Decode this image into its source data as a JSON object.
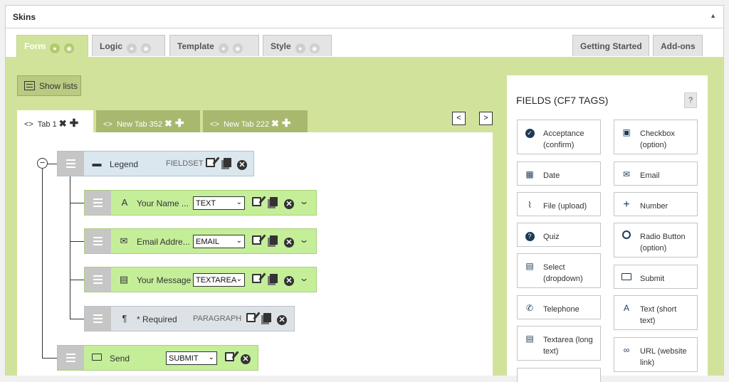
{
  "panel": {
    "title": "Skins"
  },
  "top_tabs": [
    {
      "label": "Form",
      "active": true
    },
    {
      "label": "Logic",
      "active": false
    },
    {
      "label": "Template",
      "active": false
    },
    {
      "label": "Style",
      "active": false
    }
  ],
  "right_tabs": [
    {
      "label": "Getting Started"
    },
    {
      "label": "Add-ons"
    }
  ],
  "show_lists_label": "Show lists",
  "sub_tabs": [
    {
      "label": "Tab 1",
      "active": true
    },
    {
      "label": "New Tab 352",
      "active": false
    },
    {
      "label": "New Tab 222",
      "active": false
    }
  ],
  "form_rows": [
    {
      "label": "Legend",
      "type": "FIELDSET",
      "icon": "folder-icon"
    },
    {
      "label": "Your Name ...",
      "type": "TEXT",
      "icon": "text-icon"
    },
    {
      "label": "Email Addre...",
      "type": "EMAIL",
      "icon": "envelope-icon"
    },
    {
      "label": "Your Message",
      "type": "TEXTAREA",
      "icon": "textarea-icon"
    },
    {
      "label": "* Required",
      "type": "PARAGRAPH",
      "icon": "paragraph-icon"
    },
    {
      "label": "Send",
      "type": "SUBMIT",
      "icon": "button-icon"
    }
  ],
  "sidebar": {
    "title": "FIELDS (CF7 TAGS)",
    "help": "?",
    "fields": [
      {
        "label": "Acceptance (confirm)",
        "icon": "check-circle-icon"
      },
      {
        "label": "Checkbox (option)",
        "icon": "checkbox-icon"
      },
      {
        "label": "Date",
        "icon": "calendar-icon"
      },
      {
        "label": "Email",
        "icon": "envelope-icon"
      },
      {
        "label": "File (upload)",
        "icon": "paperclip-icon"
      },
      {
        "label": "Number",
        "icon": "plus-icon"
      },
      {
        "label": "Quiz",
        "icon": "question-circle-icon"
      },
      {
        "label": "Radio Button (option)",
        "icon": "radio-icon"
      },
      {
        "label": "Select (dropdown)",
        "icon": "list-icon"
      },
      {
        "label": "Submit",
        "icon": "button-icon"
      },
      {
        "label": "Telephone",
        "icon": "phone-icon"
      },
      {
        "label": "Text (short text)",
        "icon": "text-icon"
      },
      {
        "label": "Textarea (long text)",
        "icon": "textarea-icon"
      },
      {
        "label": "URL (website link)",
        "icon": "link-icon"
      }
    ]
  },
  "colors": {
    "accent_green": "#d1e39b",
    "row_green": "#c5ee99",
    "row_blue": "#dae7ee",
    "icon_blue": "#1d3a56"
  }
}
